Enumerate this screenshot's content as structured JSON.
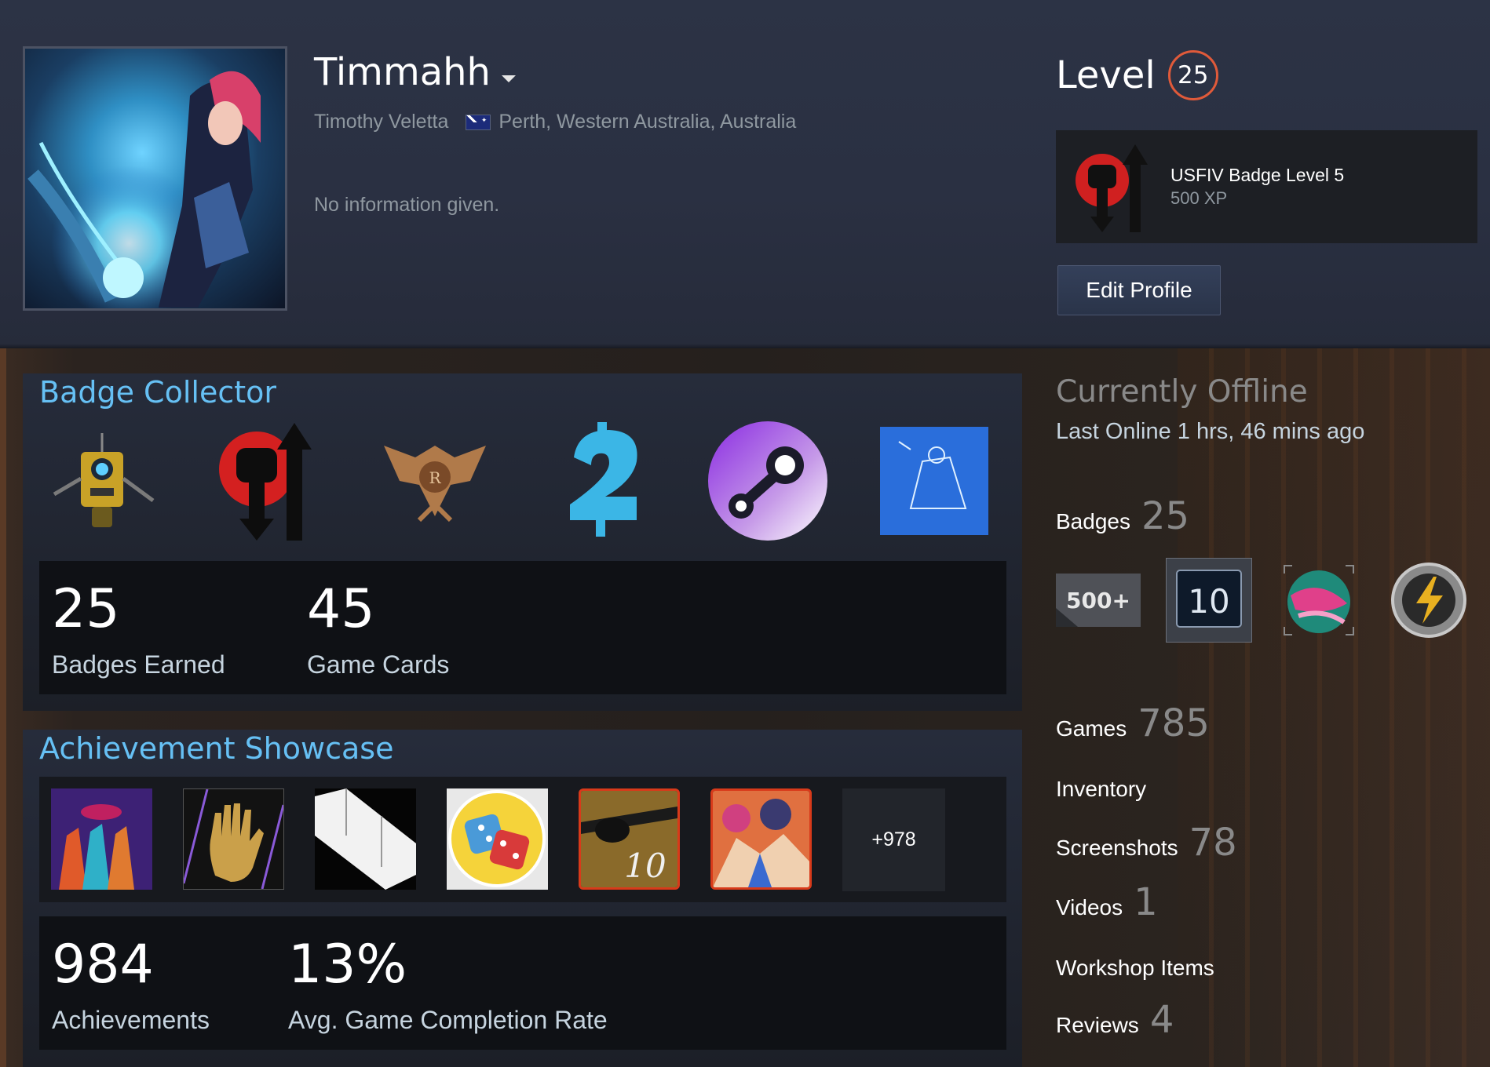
{
  "profile": {
    "username": "Timmahh",
    "real_name": "Timothy Veletta",
    "location": "Perth, Western Australia, Australia",
    "summary": "No information given."
  },
  "level": {
    "label": "Level",
    "value": "25",
    "ring_color": "#e05a3a"
  },
  "favorite_badge": {
    "name": "USFIV Badge Level 5",
    "xp": "500 XP"
  },
  "edit_profile_label": "Edit Profile",
  "badge_collector": {
    "title": "Badge Collector",
    "badges": [
      "claptrap-badge-icon",
      "usfiv-badge-icon",
      "eagle-emblem-badge-icon",
      "number-two-badge-icon",
      "steam-logo-badge-icon",
      "blue-sketch-badge-icon"
    ],
    "stats": [
      {
        "value": "25",
        "label": "Badges Earned"
      },
      {
        "value": "45",
        "label": "Game Cards"
      }
    ]
  },
  "achievement_showcase": {
    "title": "Achievement Showcase",
    "more_label": "+978",
    "stats": [
      {
        "value": "984",
        "label": "Achievements"
      },
      {
        "value": "13%",
        "label": "Avg. Game Completion Rate"
      }
    ]
  },
  "status": {
    "title": "Currently Offline",
    "last_online": "Last Online 1 hrs, 46 mins ago"
  },
  "counts": {
    "badges": {
      "label": "Badges",
      "value": "25"
    },
    "games": {
      "label": "Games",
      "value": "785"
    },
    "inventory": {
      "label": "Inventory"
    },
    "screenshots": {
      "label": "Screenshots",
      "value": "78"
    },
    "videos": {
      "label": "Videos",
      "value": "1"
    },
    "workshop": {
      "label": "Workshop Items"
    },
    "reviews": {
      "label": "Reviews",
      "value": "4"
    }
  },
  "mini_badges": {
    "first_label": "500+",
    "second_label": "10"
  },
  "colors": {
    "accent_blue": "#66c0f4",
    "header_bg": "#2a3042",
    "level_ring": "#e05a3a"
  }
}
